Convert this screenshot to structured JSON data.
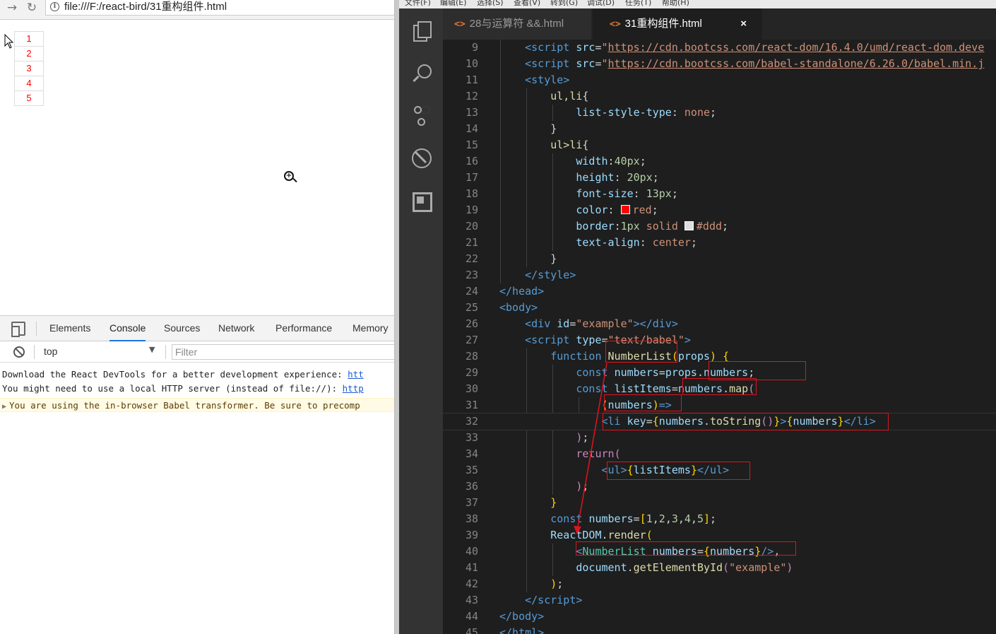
{
  "browser": {
    "url": "file:///F:/react-bird/31重构组件.html",
    "list_items": [
      "1",
      "2",
      "3",
      "4",
      "5"
    ]
  },
  "devtools": {
    "tabs": [
      "Elements",
      "Console",
      "Sources",
      "Network",
      "Performance",
      "Memory"
    ],
    "active_tab": "Console",
    "context": "top",
    "filter_placeholder": "Filter",
    "messages": [
      {
        "text": "Download the React DevTools for a better development experience: ",
        "link": "htt"
      },
      {
        "text": "You might need to use a local HTTP server (instead of file://): ",
        "link": "http"
      },
      {
        "text": "You are using the in-browser Babel transformer. Be sure to precomp",
        "link": ""
      }
    ]
  },
  "editor": {
    "menu": [
      "文件(F)",
      "编辑(E)",
      "选择(S)",
      "查看(V)",
      "转到(G)",
      "调试(D)",
      "任务(T)",
      "帮助(H)"
    ],
    "tabs": [
      {
        "label": "28与运算符 &&.html",
        "active": false
      },
      {
        "label": "31重构组件.html",
        "active": true
      }
    ],
    "close_glyph": "×",
    "swatches": {
      "red": "#ff0000",
      "ddd": "#dddddd"
    },
    "line_numbers": [
      "9",
      "10",
      "11",
      "12",
      "13",
      "14",
      "15",
      "16",
      "17",
      "18",
      "19",
      "20",
      "21",
      "22",
      "23",
      "24",
      "25",
      "26",
      "27",
      "28",
      "29",
      "30",
      "31",
      "32",
      "33",
      "34",
      "35",
      "36",
      "37",
      "38",
      "39",
      "40",
      "41",
      "42",
      "43",
      "44",
      "45"
    ]
  },
  "colors": {
    "accent": "#1a73e8",
    "annotation_box": "#e0141e",
    "list_text": "#ff0000"
  }
}
